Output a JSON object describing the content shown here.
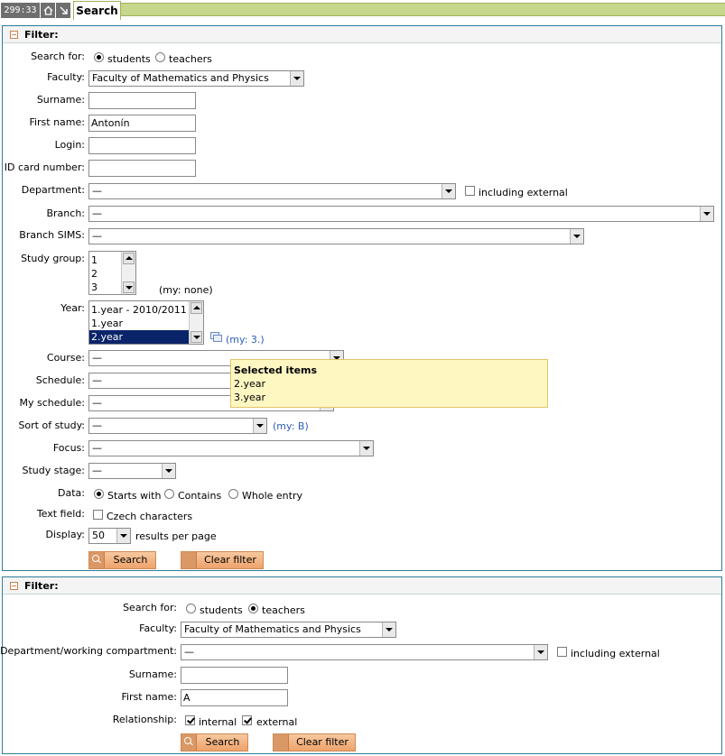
{
  "topbar": {
    "clock": "299:33",
    "tab_label": "Search"
  },
  "panel1": {
    "title": "Filter:",
    "search_for": {
      "label": "Search for:",
      "opt_students": "students",
      "opt_teachers": "teachers",
      "selected": "students"
    },
    "faculty": {
      "label": "Faculty:",
      "value": "Faculty of Mathematics and Physics"
    },
    "surname": {
      "label": "Surname:",
      "value": ""
    },
    "first_name": {
      "label": "First name:",
      "value": "Antonín"
    },
    "login": {
      "label": "Login:",
      "value": ""
    },
    "id_card": {
      "label": "ID card number:",
      "value": ""
    },
    "department": {
      "label": "Department:",
      "value": "—",
      "including_external": "including external",
      "including_external_checked": false
    },
    "branch": {
      "label": "Branch:",
      "value": "—"
    },
    "branch_sims": {
      "label": "Branch SIMS:",
      "value": "—"
    },
    "study_group": {
      "label": "Study group:",
      "options": [
        "1",
        "2",
        "3"
      ],
      "my": "(my: none)"
    },
    "year": {
      "label": "Year:",
      "options": [
        "1.year - 2010/2011",
        "1.year",
        "2.year"
      ],
      "selected": "2.year",
      "my": "(my: 3.)"
    },
    "course": {
      "label": "Course:",
      "value": "—"
    },
    "schedule": {
      "label": "Schedule:",
      "value": "—"
    },
    "my_schedule": {
      "label": "My schedule:",
      "value": "—"
    },
    "sort_of_study": {
      "label": "Sort of study:",
      "value": "—",
      "my": "(my: B)"
    },
    "focus": {
      "label": "Focus:",
      "value": "—"
    },
    "study_stage": {
      "label": "Study stage:",
      "value": "—"
    },
    "data": {
      "label": "Data:",
      "opt_starts": "Starts with",
      "opt_contains": "Contains",
      "opt_whole": "Whole entry",
      "selected": "Starts with"
    },
    "text_field": {
      "label": "Text field:",
      "czech": "Czech characters",
      "czech_checked": false
    },
    "display": {
      "label": "Display:",
      "value": "50",
      "suffix": "results per page"
    },
    "search_button": "Search",
    "clear_button": "Clear filter"
  },
  "tooltip": {
    "title": "Selected items",
    "items": [
      "2.year",
      "3.year"
    ]
  },
  "panel2": {
    "title": "Filter:",
    "search_for": {
      "label": "Search for:",
      "opt_students": "students",
      "opt_teachers": "teachers",
      "selected": "teachers"
    },
    "faculty": {
      "label": "Faculty:",
      "value": "Faculty of Mathematics and Physics"
    },
    "department": {
      "label": "Department/working compartment:",
      "value": "—",
      "including_external": "including external",
      "including_external_checked": false
    },
    "surname": {
      "label": "Surname:",
      "value": ""
    },
    "first_name": {
      "label": "First name:",
      "value": "A"
    },
    "relationship": {
      "label": "Relationship:",
      "internal": "internal",
      "external": "external",
      "internal_checked": true,
      "external_checked": true
    },
    "search_button": "Search",
    "clear_button": "Clear filter"
  },
  "colors": {
    "accent_border": "#2d7d9a",
    "top_strip": "#c6d68a",
    "button": "#eea36b",
    "tooltip_bg": "#fff7c2",
    "link_blue": "#2d5fb5"
  }
}
